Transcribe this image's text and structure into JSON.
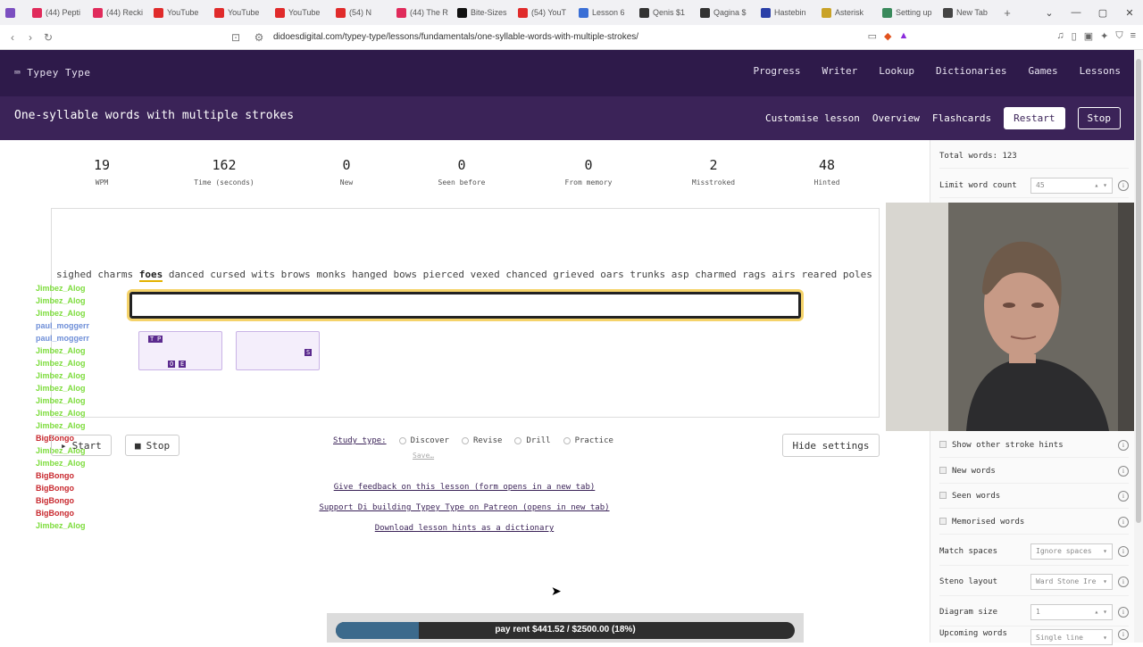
{
  "browser": {
    "tabs": [
      {
        "label": "(44) Pepti",
        "color": "#e02b5b"
      },
      {
        "label": "(44) Recki",
        "color": "#e02b5b"
      },
      {
        "label": "YouTube",
        "color": "#e02b2b"
      },
      {
        "label": "YouTube",
        "color": "#e02b2b"
      },
      {
        "label": "YouTube",
        "color": "#e02b2b"
      },
      {
        "label": "(54) N",
        "color": "#e02b2b"
      },
      {
        "label": "(44) The R",
        "color": "#e02b5b"
      },
      {
        "label": "Bite-Sizes",
        "color": "#111111"
      },
      {
        "label": "(54) YouT",
        "color": "#e02b2b"
      },
      {
        "label": "Lesson 6",
        "color": "#3a6fd6"
      },
      {
        "label": "Qenis $1",
        "color": "#333333"
      },
      {
        "label": "Qagina $",
        "color": "#333333"
      },
      {
        "label": "Hastebin",
        "color": "#2a3fa8"
      },
      {
        "label": "Asterisk",
        "color": "#c9a227"
      },
      {
        "label": "Setting up",
        "color": "#3a8a5c"
      },
      {
        "label": "New Tab",
        "color": "#444444"
      }
    ],
    "url": "didoesdigital.com/typey-type/lessons/fundamentals/one-syllable-words-with-multiple-strokes/"
  },
  "nav": {
    "brand": "Typey Type",
    "links": [
      "Progress",
      "Writer",
      "Lookup",
      "Dictionaries",
      "Games",
      "Lessons"
    ]
  },
  "lesson": {
    "title": "One-syllable words with multiple strokes",
    "customise": "Customise lesson",
    "overview": "Overview",
    "flashcards": "Flashcards",
    "restart": "Restart",
    "stop": "Stop"
  },
  "stats": [
    {
      "value": "19",
      "label": "WPM"
    },
    {
      "value": "162",
      "label": "Time (seconds)"
    },
    {
      "value": "0",
      "label": "New"
    },
    {
      "value": "0",
      "label": "Seen before"
    },
    {
      "value": "0",
      "label": "From memory"
    },
    {
      "value": "2",
      "label": "Misstroked"
    },
    {
      "value": "48",
      "label": "Hinted"
    }
  ],
  "material": {
    "before": "sighed charms",
    "current": "foes",
    "after": "danced cursed wits brows monks hanged bows pierced vexed chanced grieved oars trunks asp charmed rags airs reared poles he"
  },
  "steno_keys": {
    "first": [
      "T",
      "P",
      "O",
      "E"
    ],
    "second": [
      "S"
    ]
  },
  "chat": [
    {
      "user": "Jimbez_Alog",
      "color": "#7ddc3c"
    },
    {
      "user": "Jimbez_Alog",
      "color": "#7ddc3c"
    },
    {
      "user": "Jimbez_Alog",
      "color": "#7ddc3c"
    },
    {
      "user": "paul_moggerr",
      "color": "#6f8fd8"
    },
    {
      "user": "paul_moggerr",
      "color": "#6f8fd8"
    },
    {
      "user": "Jimbez_Alog",
      "color": "#7ddc3c"
    },
    {
      "user": "Jimbez_Alog",
      "color": "#7ddc3c"
    },
    {
      "user": "Jimbez_Alog",
      "color": "#7ddc3c"
    },
    {
      "user": "Jimbez_Alog",
      "color": "#7ddc3c"
    },
    {
      "user": "Jimbez_Alog",
      "color": "#7ddc3c"
    },
    {
      "user": "Jimbez_Alog",
      "color": "#7ddc3c"
    },
    {
      "user": "Jimbez_Alog",
      "color": "#7ddc3c"
    },
    {
      "user": "BigBongo",
      "color": "#c8282e"
    },
    {
      "user": "Jimbez_Alog",
      "color": "#7ddc3c"
    },
    {
      "user": "Jimbez_Alog",
      "color": "#7ddc3c"
    },
    {
      "user": "BigBongo",
      "color": "#c8282e"
    },
    {
      "user": "BigBongo",
      "color": "#c8282e"
    },
    {
      "user": "BigBongo",
      "color": "#c8282e"
    },
    {
      "user": "BigBongo",
      "color": "#c8282e"
    },
    {
      "user": "Jimbez_Alog",
      "color": "#7ddc3c"
    }
  ],
  "controls": {
    "start": "Start",
    "stop": "Stop",
    "study_type_label": "Study type:",
    "study_types": [
      "Discover",
      "Revise",
      "Drill",
      "Practice"
    ],
    "save": "Save…",
    "hide_settings": "Hide settings"
  },
  "links": [
    "Give feedback on this lesson (form opens in a new tab)",
    "Support Di building Typey Type on Patreon (opens in new tab)",
    "Download lesson hints as a dictionary"
  ],
  "goal": {
    "text": "pay rent $441.52 / $2500.00 (18%)",
    "fraction": 0.18
  },
  "settings": {
    "total_words": "Total words: 123",
    "limit_word_count": "Limit word count",
    "limit_value": "45",
    "show_other_stroke_hints": "Show other stroke hints",
    "new_words": "New words",
    "seen_words": "Seen words",
    "memorised_words": "Memorised words",
    "match_spaces": "Match spaces",
    "match_spaces_value": "Ignore spaces",
    "steno_layout": "Steno layout",
    "steno_layout_value": "Ward Stone Ire",
    "diagram_size": "Diagram size",
    "diagram_size_value": "1",
    "upcoming_words": "Upcoming words",
    "upcoming_words_value": "Single line"
  }
}
